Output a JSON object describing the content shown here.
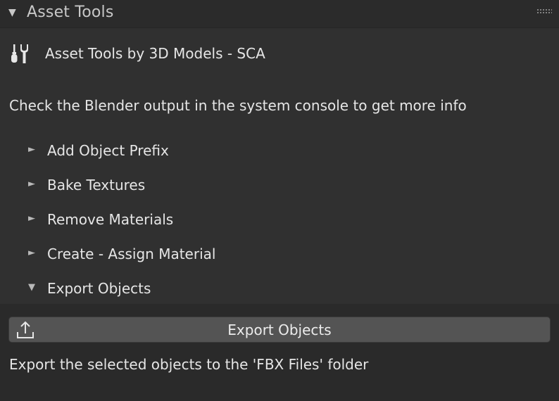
{
  "panel": {
    "title": "Asset Tools",
    "header_arrow": "▼",
    "header_icon": "grip-icon"
  },
  "brand": {
    "icon": "tools-icon",
    "text": "Asset Tools by 3D Models - SCA"
  },
  "info": {
    "text": "Check the Blender output in the system console to get more info"
  },
  "subpanels": [
    {
      "label": "Add Object Prefix",
      "arrow": "►",
      "expanded": false
    },
    {
      "label": "Bake Textures",
      "arrow": "►",
      "expanded": false
    },
    {
      "label": "Remove Materials",
      "arrow": "►",
      "expanded": false
    },
    {
      "label": "Create - Assign Material",
      "arrow": "►",
      "expanded": false
    },
    {
      "label": "Export Objects",
      "arrow": "▼",
      "expanded": true
    }
  ],
  "export": {
    "button_label": "Export Objects",
    "button_icon": "export-icon",
    "description": "Export the selected objects to the 'FBX Files' folder"
  },
  "colors": {
    "panel_bg": "#303030",
    "header_bg": "#2b2b2b",
    "button_bg": "#545454",
    "text": "#e6e6e6"
  }
}
